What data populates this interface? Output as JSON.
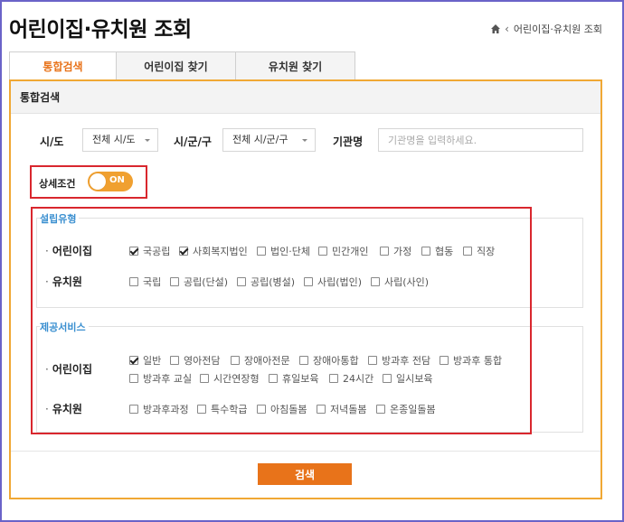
{
  "page_title": "어린이집·유치원 조회",
  "breadcrumb": {
    "current": "어린이집·유치원 조회"
  },
  "tabs": [
    {
      "label": "통합검색",
      "active": true
    },
    {
      "label": "어린이집 찾기",
      "active": false
    },
    {
      "label": "유치원 찾기",
      "active": false
    }
  ],
  "panel": {
    "title": "통합검색"
  },
  "filters": {
    "sido_label": "시/도",
    "sido_value": "전체 시/도",
    "sigungu_label": "시/군/구",
    "sigungu_value": "전체 시/군/구",
    "name_label": "기관명",
    "name_placeholder": "기관명을 입력하세요."
  },
  "detail": {
    "label": "상세조건",
    "toggle_text": "ON",
    "toggle_on": true
  },
  "establish": {
    "title": "설립유형",
    "daycare_label": "어린이집",
    "daycare_options": [
      {
        "label": "국공립",
        "checked": true
      },
      {
        "label": "사회복지법인",
        "checked": true
      },
      {
        "label": "법인·단체",
        "checked": false
      },
      {
        "label": "민간개인",
        "checked": false
      },
      {
        "label": "가정",
        "checked": false
      },
      {
        "label": "협동",
        "checked": false
      },
      {
        "label": "직장",
        "checked": false
      }
    ],
    "kinder_label": "유치원",
    "kinder_options": [
      {
        "label": "국립",
        "checked": false
      },
      {
        "label": "공립(단설)",
        "checked": false
      },
      {
        "label": "공립(병설)",
        "checked": false
      },
      {
        "label": "사립(법인)",
        "checked": false
      },
      {
        "label": "사립(사인)",
        "checked": false
      }
    ]
  },
  "services": {
    "title": "제공서비스",
    "daycare_label": "어린이집",
    "daycare_options": [
      {
        "label": "일반",
        "checked": true
      },
      {
        "label": "영아전담",
        "checked": false
      },
      {
        "label": "장애아전문",
        "checked": false
      },
      {
        "label": "장애아통합",
        "checked": false
      },
      {
        "label": "방과후 전담",
        "checked": false
      },
      {
        "label": "방과후 통합",
        "checked": false
      },
      {
        "label": "방과후 교실",
        "checked": false
      },
      {
        "label": "시간연장형",
        "checked": false
      },
      {
        "label": "휴일보육",
        "checked": false
      },
      {
        "label": "24시간",
        "checked": false
      },
      {
        "label": "일시보육",
        "checked": false
      }
    ],
    "kinder_label": "유치원",
    "kinder_options": [
      {
        "label": "방과후과정",
        "checked": false
      },
      {
        "label": "특수학급",
        "checked": false
      },
      {
        "label": "아침돌봄",
        "checked": false
      },
      {
        "label": "저녁돌봄",
        "checked": false
      },
      {
        "label": "온종일돌봄",
        "checked": false
      }
    ]
  },
  "search_button": "검색",
  "colors": {
    "accent_orange": "#e8731a",
    "panel_border": "#f0a834",
    "highlight_red": "#d9272e",
    "section_blue": "#3a8fd0"
  }
}
